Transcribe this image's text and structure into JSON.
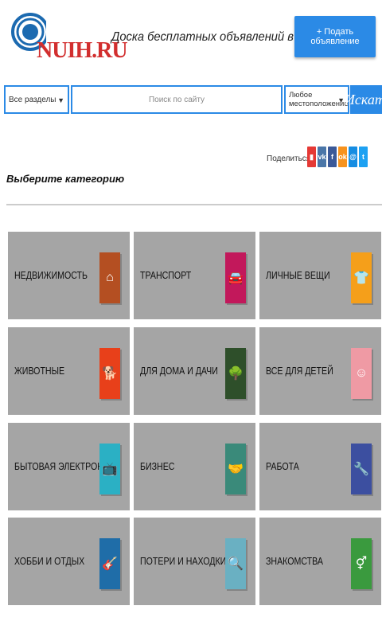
{
  "header": {
    "logo_text": "NUIH.RU",
    "tagline": "Доска бесплатных объявлений в России",
    "post_button": "+ Подать объявление"
  },
  "search": {
    "sections_value": "Все разделы",
    "query_placeholder": "Поиск по сайту",
    "location_value": "Любое местоположение",
    "submit_label": "Искать"
  },
  "share": {
    "label": "Поделиться:",
    "networks": [
      {
        "name": "bookmark",
        "glyph": "▮",
        "color": "#e53935"
      },
      {
        "name": "vk",
        "glyph": "vk",
        "color": "#4a76a8"
      },
      {
        "name": "facebook",
        "glyph": "f",
        "color": "#3b5998"
      },
      {
        "name": "odnoklassniki",
        "glyph": "ok",
        "color": "#f7931e"
      },
      {
        "name": "moimir",
        "glyph": "@",
        "color": "#168de2"
      },
      {
        "name": "twitter",
        "glyph": "t",
        "color": "#1da1f2"
      }
    ]
  },
  "main": {
    "heading": "Выберите категорию",
    "categories": [
      {
        "label": "НЕДВИЖИМОСТЬ",
        "icon": "house-icon",
        "glyph": "⌂",
        "color": "#b44f22"
      },
      {
        "label": "ТРАНСПОРТ",
        "icon": "car-icon",
        "glyph": "🚘",
        "color": "#c2185b"
      },
      {
        "label": "ЛИЧНЫЕ ВЕЩИ",
        "icon": "clothes-icon",
        "glyph": "👕",
        "color": "#f59f1a"
      },
      {
        "label": "ЖИВОТНЫЕ",
        "icon": "pets-icon",
        "glyph": "🐕",
        "color": "#e8401a"
      },
      {
        "label": "ДЛЯ ДОМА И ДАЧИ",
        "icon": "tree-icon",
        "glyph": "🌳",
        "color": "#2e4f2a"
      },
      {
        "label": "ВСЕ ДЛЯ ДЕТЕЙ",
        "icon": "baby-icon",
        "glyph": "☺",
        "color": "#ef9aa4"
      },
      {
        "label": "БЫТОВАЯ ЭЛЕКТРОНИКА",
        "icon": "tv-icon",
        "glyph": "📺",
        "color": "#2bb0c4"
      },
      {
        "label": "БИЗНЕС",
        "icon": "handshake-icon",
        "glyph": "🤝",
        "color": "#3a8a7a"
      },
      {
        "label": "РАБОТА",
        "icon": "wrench-icon",
        "glyph": "🔧",
        "color": "#3c4fa0"
      },
      {
        "label": "ХОББИ И ОТДЫХ",
        "icon": "guitar-icon",
        "glyph": "🎸",
        "color": "#1f6da8"
      },
      {
        "label": "ПОТЕРИ И НАХОДКИ",
        "icon": "magnifier-icon",
        "glyph": "🔍",
        "color": "#6ab0c2"
      },
      {
        "label": "ЗНАКОМСТВА",
        "icon": "gender-icon",
        "glyph": "⚥",
        "color": "#3a9a3e"
      }
    ]
  }
}
